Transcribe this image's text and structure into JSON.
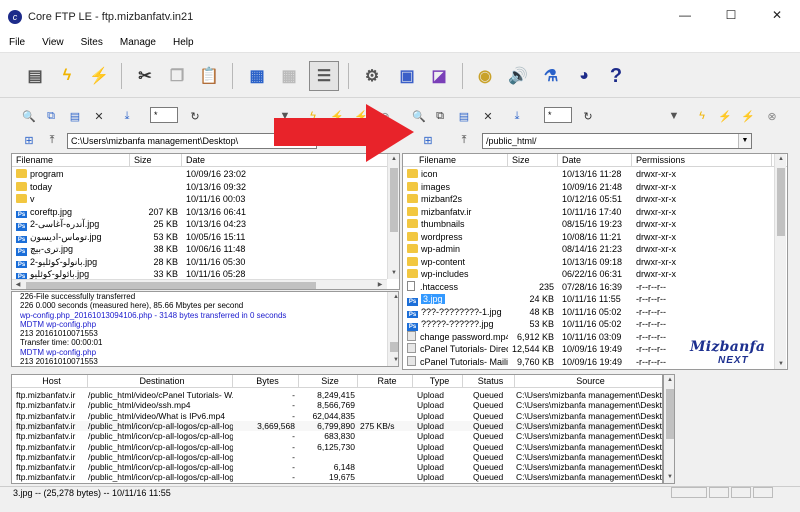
{
  "window": {
    "title": "Core FTP LE - ftp.mizbanfatv.in21",
    "minimize_glyph": "—",
    "maximize_glyph": "☐",
    "close_glyph": "✕"
  },
  "menu": [
    "File",
    "View",
    "Sites",
    "Manage",
    "Help"
  ],
  "toolbar_icons": [
    "site-manager-icon",
    "quick-connect-icon",
    "disconnect-icon",
    "cut-icon",
    "copy-icon",
    "paste-icon",
    "view-list-icon",
    "view-details-icon",
    "view-icons-icon",
    "settings-gear-icon",
    "transfer-queue-icon",
    "file-viewer-icon",
    "eye-view-icon",
    "sound-icon",
    "connections-icon",
    "about-icon",
    "help-icon"
  ],
  "local": {
    "path": "C:\\Users\\mizbanfa management\\Desktop\\",
    "filter": "*",
    "columns": {
      "name": "Filename",
      "size": "Size",
      "date": "Date"
    },
    "files": [
      {
        "name": "program",
        "size": "",
        "date": "10/09/16 23:02",
        "type": "folder"
      },
      {
        "name": "today",
        "size": "",
        "date": "10/13/16 09:32",
        "type": "folder"
      },
      {
        "name": "v",
        "size": "",
        "date": "10/11/16 00:03",
        "type": "folder"
      },
      {
        "name": "coreftp.jpg",
        "size": "207 KB",
        "date": "10/13/16 06:41",
        "type": "ps"
      },
      {
        "name": "آندره-آغاسی-2.jpg",
        "size": "25 KB",
        "date": "10/13/16 04:23",
        "type": "ps"
      },
      {
        "name": "توماس-ادیسون.jpg",
        "size": "53 KB",
        "date": "10/05/16 15:11",
        "type": "ps"
      },
      {
        "name": "تری-بیچ.jpg",
        "size": "38 KB",
        "date": "10/06/16 11:48",
        "type": "ps"
      },
      {
        "name": "بانولو-کوئلیو-2.jpg",
        "size": "28 KB",
        "date": "10/11/16 05:30",
        "type": "ps"
      },
      {
        "name": "بائولو-کوئلیو.jpg",
        "size": "33 KB",
        "date": "10/11/16 05:28",
        "type": "ps"
      }
    ]
  },
  "remote": {
    "path": "/public_html/",
    "filter": "*",
    "columns": {
      "name": "Filename",
      "size": "Size",
      "date": "Date",
      "permissions": "Permissions"
    },
    "files": [
      {
        "name": "icon",
        "size": "",
        "date": "10/13/16 11:28",
        "perm": "drwxr-xr-x",
        "type": "folder"
      },
      {
        "name": "images",
        "size": "",
        "date": "10/09/16 21:48",
        "perm": "drwxr-xr-x",
        "type": "folder"
      },
      {
        "name": "mizbanf2s",
        "size": "",
        "date": "10/12/16 05:51",
        "perm": "drwxr-xr-x",
        "type": "folder"
      },
      {
        "name": "mizbanfatv.ir",
        "size": "",
        "date": "10/11/16 17:40",
        "perm": "drwxr-xr-x",
        "type": "folder"
      },
      {
        "name": "thumbnails",
        "size": "",
        "date": "08/15/16 19:23",
        "perm": "drwxr-xr-x",
        "type": "folder"
      },
      {
        "name": "wordpress",
        "size": "",
        "date": "10/08/16 11:21",
        "perm": "drwxr-xr-x",
        "type": "folder"
      },
      {
        "name": "wp-admin",
        "size": "",
        "date": "08/14/16 21:23",
        "perm": "drwxr-xr-x",
        "type": "folder"
      },
      {
        "name": "wp-content",
        "size": "",
        "date": "10/13/16 09:18",
        "perm": "drwxr-xr-x",
        "type": "folder"
      },
      {
        "name": "wp-includes",
        "size": "",
        "date": "06/22/16 06:31",
        "perm": "drwxr-xr-x",
        "type": "folder"
      },
      {
        "name": ".htaccess",
        "size": "235",
        "date": "07/28/16 16:39",
        "perm": "-r--r--r--",
        "type": "file"
      },
      {
        "name": "3.jpg",
        "size": "24 KB",
        "date": "10/11/16 11:55",
        "perm": "-r--r--r--",
        "type": "ps",
        "selected": true
      },
      {
        "name": "???-????????-1.jpg",
        "size": "48 KB",
        "date": "10/11/16 05:02",
        "perm": "-r--r--r--",
        "type": "ps"
      },
      {
        "name": "?????-??????.jpg",
        "size": "53 KB",
        "date": "10/11/16 05:02",
        "perm": "-r--r--r--",
        "type": "ps"
      },
      {
        "name": "change password.mp4",
        "size": "6,912 KB",
        "date": "10/11/16 03:09",
        "perm": "-r--r--r--",
        "type": "doc"
      },
      {
        "name": "cPanel Tutorials- Direc...",
        "size": "12,544 KB",
        "date": "10/09/16 19:49",
        "perm": "-r--r--r--",
        "type": "doc"
      },
      {
        "name": "cPanel Tutorials- Maili...",
        "size": "9,760 KB",
        "date": "10/09/16 19:49",
        "perm": "-r--r--r--",
        "type": "doc"
      }
    ]
  },
  "log": [
    {
      "text": "226-File successfully transferred",
      "blue": false
    },
    {
      "text": "226 0.000 seconds (measured here), 85.66 Mbytes per second",
      "blue": false
    },
    {
      "text": "wp-config.php_20161013094106.php - 3148 bytes transferred in 0 seconds",
      "blue": true
    },
    {
      "text": "MDTM wp-config.php",
      "blue": true
    },
    {
      "text": "213 20161010071553",
      "blue": false
    },
    {
      "text": "Transfer time: 00:00:01",
      "blue": false
    },
    {
      "text": "MDTM wp-config.php",
      "blue": true
    },
    {
      "text": "213 20161010071553",
      "blue": false
    }
  ],
  "queue": {
    "columns": {
      "host": "Host",
      "destination": "Destination",
      "bytes": "Bytes",
      "size": "Size",
      "rate": "Rate",
      "type": "Type",
      "status": "Status",
      "source": "Source"
    },
    "rows": [
      {
        "host": "ftp.mizbanfatv.ir",
        "dest": "/public_html/video/cPanel Tutorials- W...",
        "bytes": "-",
        "size": "8,249,415",
        "rate": "",
        "type": "Upload",
        "status": "Queued",
        "source": "C:\\Users\\mizbanfa management\\Deskt..."
      },
      {
        "host": "ftp.mizbanfatv.ir",
        "dest": "/public_html/video/ssh.mp4",
        "bytes": "-",
        "size": "8,566,769",
        "rate": "",
        "type": "Upload",
        "status": "Queued",
        "source": "C:\\Users\\mizbanfa management\\Deskt..."
      },
      {
        "host": "ftp.mizbanfatv.ir",
        "dest": "/public_html/video/What is IPv6.mp4",
        "bytes": "-",
        "size": "62,044,835",
        "rate": "",
        "type": "Upload",
        "status": "Queued",
        "source": "C:\\Users\\mizbanfa management\\Deskt..."
      },
      {
        "host": "ftp.mizbanfatv.ir",
        "dest": "/public_html/icon/cp-all-logos/cp-all-logo...",
        "bytes": "3,669,568",
        "size": "6,799,890",
        "rate": "275 KB/s",
        "type": "Upload",
        "status": "Queued",
        "source": "C:\\Users\\mizbanfa management\\Deskt..."
      },
      {
        "host": "ftp.mizbanfatv.ir",
        "dest": "/public_html/icon/cp-all-logos/cp-all-logo...",
        "bytes": "-",
        "size": "683,830",
        "rate": "",
        "type": "Upload",
        "status": "Queued",
        "source": "C:\\Users\\mizbanfa management\\Deskt..."
      },
      {
        "host": "ftp.mizbanfatv.ir",
        "dest": "/public_html/icon/cp-all-logos/cp-all-logo...",
        "bytes": "-",
        "size": "6,125,730",
        "rate": "",
        "type": "Upload",
        "status": "Queued",
        "source": "C:\\Users\\mizbanfa management\\Deskt..."
      },
      {
        "host": "ftp.mizbanfatv.ir",
        "dest": "/public_html/icon/cp-all-logos/cp-all-logo...",
        "bytes": "-",
        "size": "",
        "rate": "",
        "type": "Upload",
        "status": "Queued",
        "source": "C:\\Users\\mizbanfa management\\Deskt..."
      },
      {
        "host": "ftp.mizbanfatv.ir",
        "dest": "/public_html/icon/cp-all-logos/cp-all-logo...",
        "bytes": "-",
        "size": "6,148",
        "rate": "",
        "type": "Upload",
        "status": "Queued",
        "source": "C:\\Users\\mizbanfa management\\Deskt..."
      },
      {
        "host": "ftp.mizbanfatv.ir",
        "dest": "/public_html/icon/cp-all-logos/cp-all-logo...",
        "bytes": "-",
        "size": "19,675",
        "rate": "",
        "type": "Upload",
        "status": "Queued",
        "source": "C:\\Users\\mizbanfa management\\Deskt..."
      }
    ]
  },
  "status": {
    "text": "3.jpg -- (25,278 bytes) -- 10/11/16 11:55"
  },
  "watermark": {
    "line1": "Mizbanfa",
    "line2": "NEXT"
  },
  "colors": {
    "selection": "#3399ff",
    "arrow": "#e8232a",
    "log_blue": "#1a1acd",
    "logo": "#1c2f8f"
  }
}
